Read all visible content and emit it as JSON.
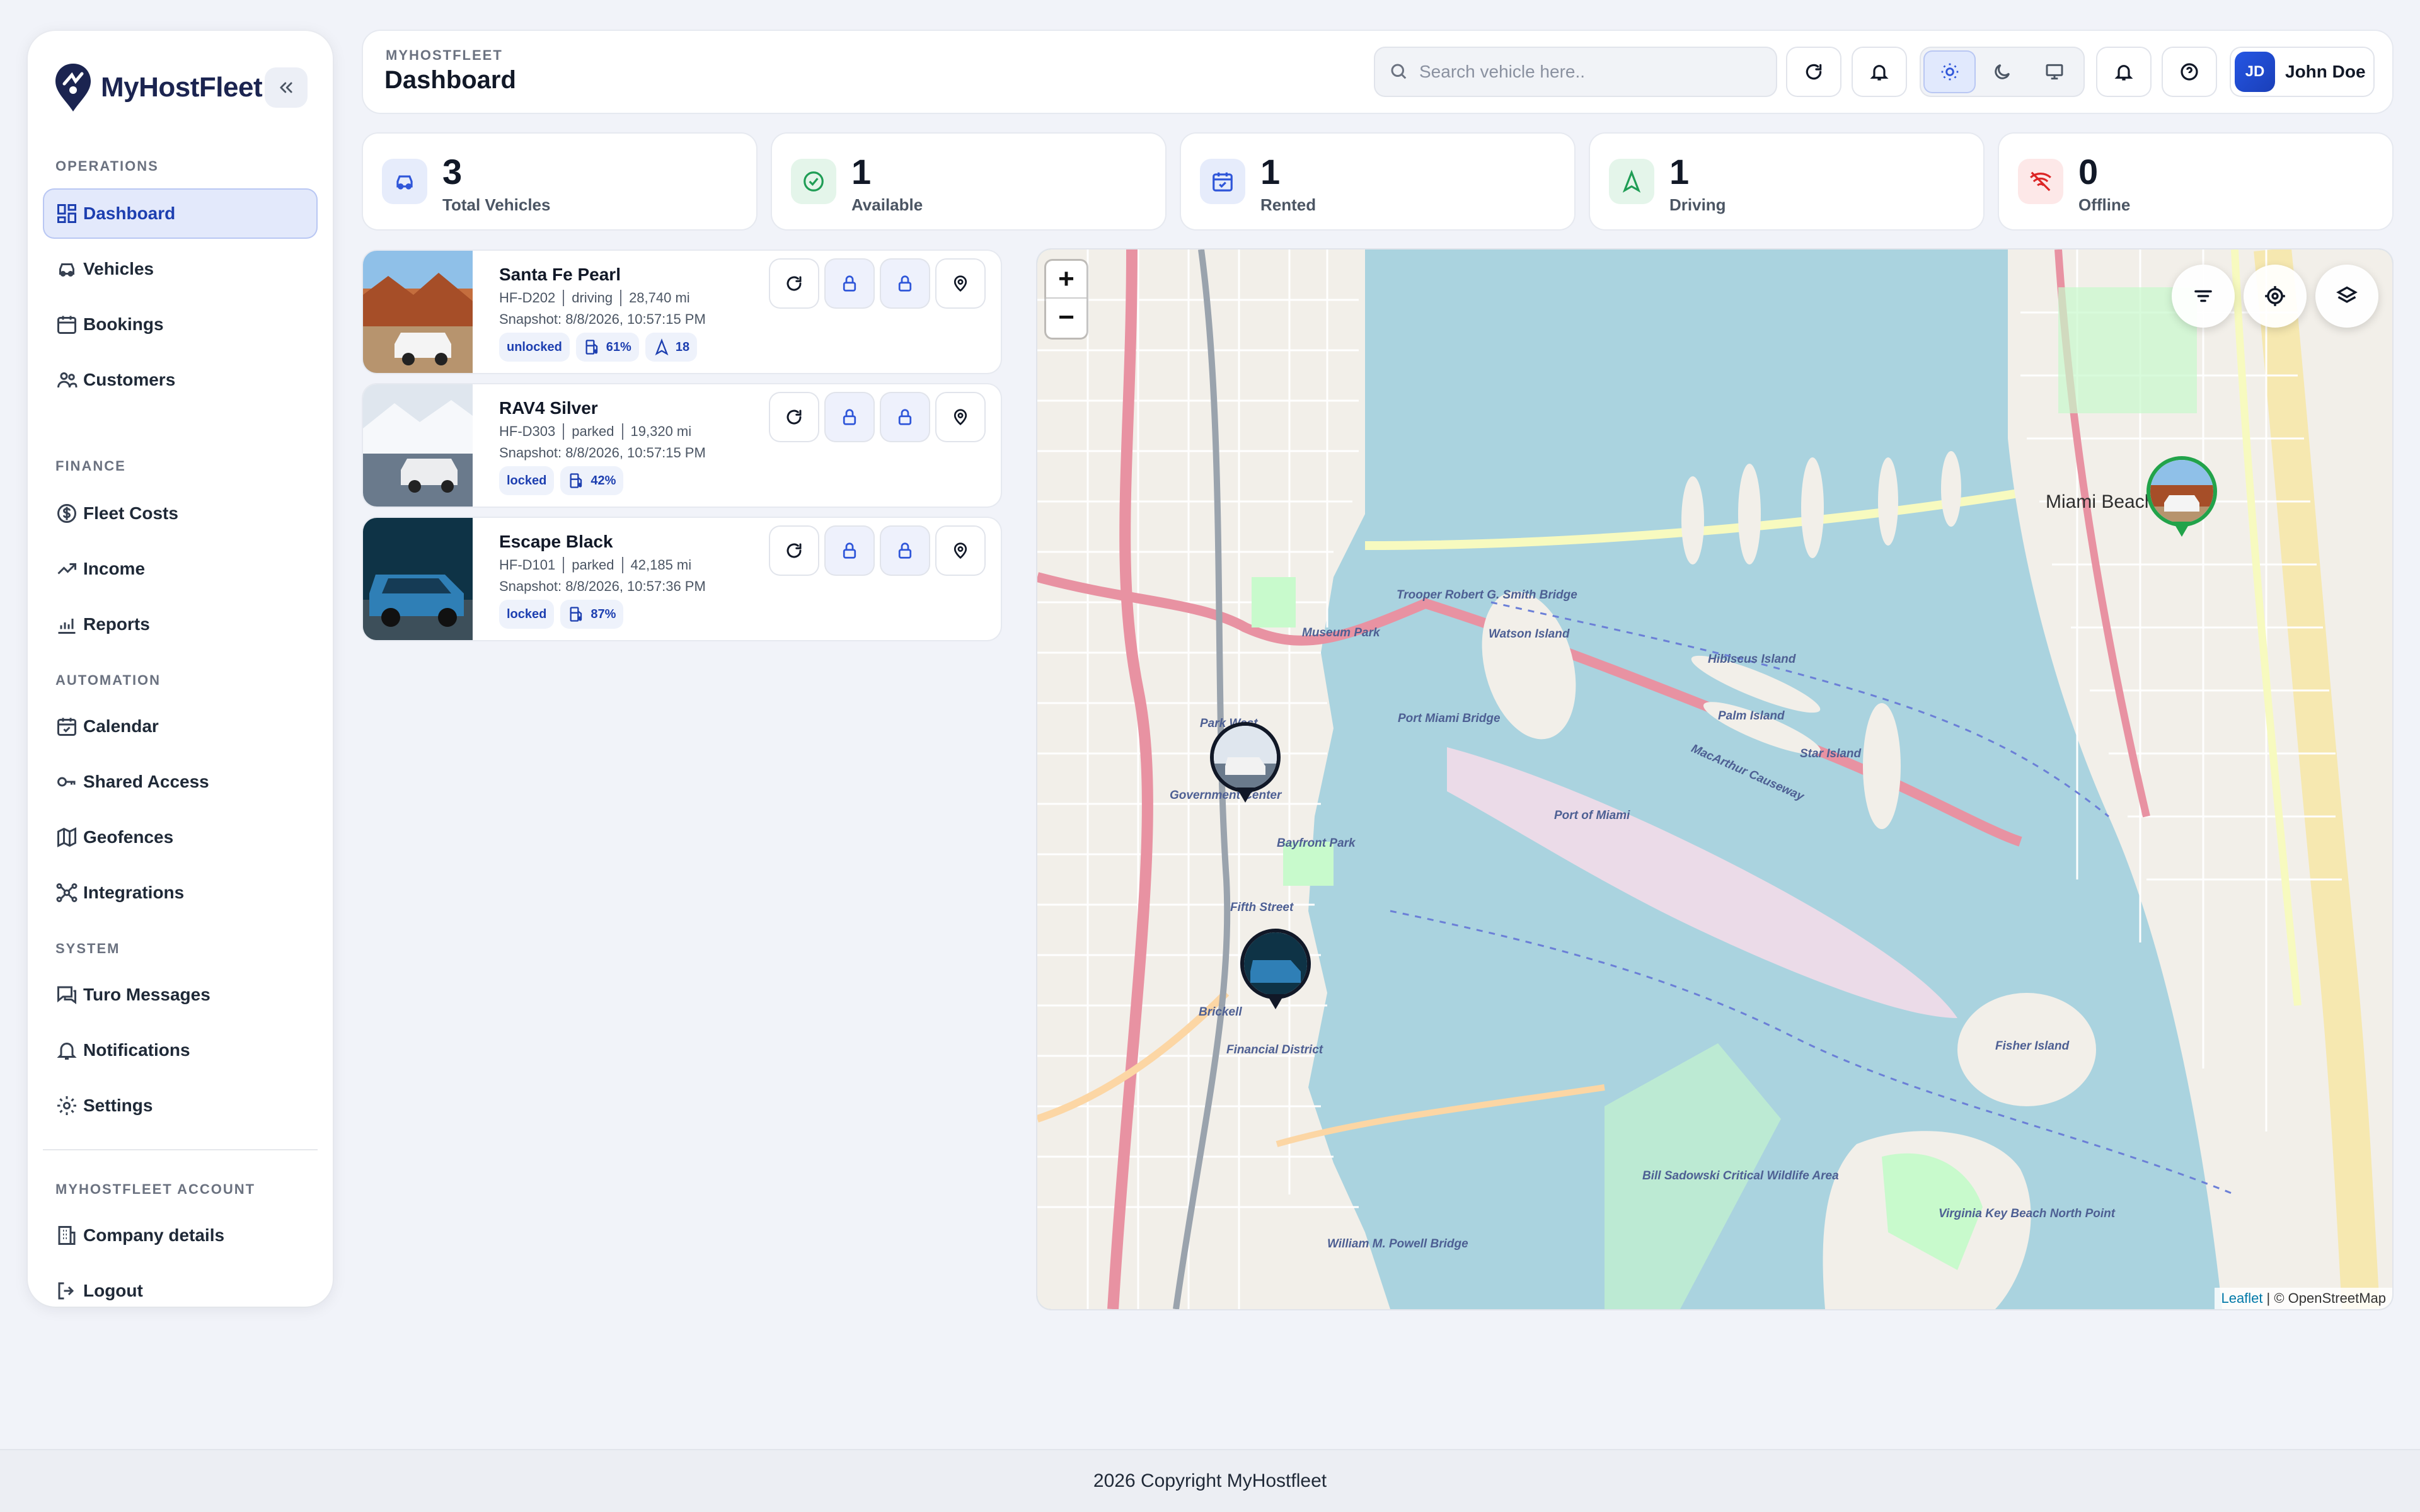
{
  "brand": {
    "name": "MyHostFleet"
  },
  "sidebar": {
    "sections": [
      {
        "title": "OPERATIONS",
        "items": [
          {
            "label": "Dashboard",
            "icon": "dashboard-icon",
            "active": true
          },
          {
            "label": "Vehicles",
            "icon": "car-icon"
          },
          {
            "label": "Bookings",
            "icon": "calendar-grid-icon"
          },
          {
            "label": "Customers",
            "icon": "users-icon"
          }
        ]
      },
      {
        "title": "FINANCE",
        "items": [
          {
            "label": "Fleet Costs",
            "icon": "dollar-circle-icon"
          },
          {
            "label": "Income",
            "icon": "trending-up-icon"
          },
          {
            "label": "Reports",
            "icon": "bar-chart-icon"
          }
        ]
      },
      {
        "title": "AUTOMATION",
        "items": [
          {
            "label": "Calendar",
            "icon": "calendar-check-icon"
          },
          {
            "label": "Shared Access",
            "icon": "key-icon"
          },
          {
            "label": "Geofences",
            "icon": "map-icon"
          },
          {
            "label": "Integrations",
            "icon": "network-icon"
          }
        ]
      },
      {
        "title": "SYSTEM",
        "items": [
          {
            "label": "Turo Messages",
            "icon": "messages-icon"
          },
          {
            "label": "Notifications",
            "icon": "bell-icon"
          },
          {
            "label": "Settings",
            "icon": "gear-icon"
          }
        ]
      },
      {
        "title": "MYHOSTFLEET ACCOUNT",
        "items": [
          {
            "label": "Company details",
            "icon": "building-icon"
          },
          {
            "label": "Logout",
            "icon": "logout-icon"
          }
        ]
      }
    ]
  },
  "header": {
    "eyebrow": "MYHOSTFLEET",
    "title": "Dashboard",
    "search_placeholder": "Search vehicle here..",
    "user": {
      "initials": "JD",
      "name": "John Doe"
    }
  },
  "stats": [
    {
      "value": "3",
      "label": "Total Vehicles",
      "icon": "car-icon",
      "color": "#2f56d9",
      "bg": "#e6ecfb"
    },
    {
      "value": "1",
      "label": "Available",
      "icon": "check-circle-icon",
      "color": "#1f9d55",
      "bg": "#e4f5ea"
    },
    {
      "value": "1",
      "label": "Rented",
      "icon": "calendar-check-icon",
      "color": "#2f56d9",
      "bg": "#e6ecfb"
    },
    {
      "value": "1",
      "label": "Driving",
      "icon": "navigation-icon",
      "color": "#1f9d55",
      "bg": "#e4f5ea"
    },
    {
      "value": "0",
      "label": "Offline",
      "icon": "wifi-off-icon",
      "color": "#dc2626",
      "bg": "#fde8e8"
    }
  ],
  "vehicles": [
    {
      "name": "Santa Fe Pearl",
      "plate": "HF-D202",
      "state": "driving",
      "mileage": "28,740 mi",
      "snapshot": "Snapshot: 8/8/2026, 10:57:15 PM",
      "lock": "unlocked",
      "fuel": "61%",
      "speed": "18"
    },
    {
      "name": "RAV4 Silver",
      "plate": "HF-D303",
      "state": "parked",
      "mileage": "19,320 mi",
      "snapshot": "Snapshot: 8/8/2026, 10:57:15 PM",
      "lock": "locked",
      "fuel": "42%"
    },
    {
      "name": "Escape Black",
      "plate": "HF-D101",
      "state": "parked",
      "mileage": "42,185 mi",
      "snapshot": "Snapshot: 8/8/2026, 10:57:36 PM",
      "lock": "locked",
      "fuel": "87%"
    }
  ],
  "map": {
    "zoom_in": "+",
    "zoom_out": "−",
    "attribution_leaflet": "Leaflet",
    "attribution_osm": "| © OpenStreetMap",
    "labels": {
      "miami_beach": "Miami Beach",
      "port_miami_bridge": "Port Miami Bridge",
      "port_of_miami": "Port of Miami",
      "macarthur": "MacArthur Causeway",
      "fisher_island": "Fisher Island",
      "star_island": "Star Island",
      "palm_island": "Palm Island",
      "hibiscus_island": "Hibiscus Island",
      "watson_island": "Watson Island",
      "brickell": "Brickell",
      "financial_district": "Financial District",
      "fifth_street": "Fifth Street",
      "bill_sadowski": "Bill Sadowski Critical Wildlife Area",
      "virginia_key": "Virginia Key Beach North Point",
      "william_powell": "William M. Powell Bridge",
      "trooper_bridge": "Trooper Robert G. Smith Bridge",
      "park_west": "Park West",
      "government_center": "Government Center",
      "bayfront_park": "Bayfront Park",
      "museum_park": "Museum Park"
    }
  },
  "footer": {
    "copyright": "2026 Copyright MyHostfleet"
  }
}
